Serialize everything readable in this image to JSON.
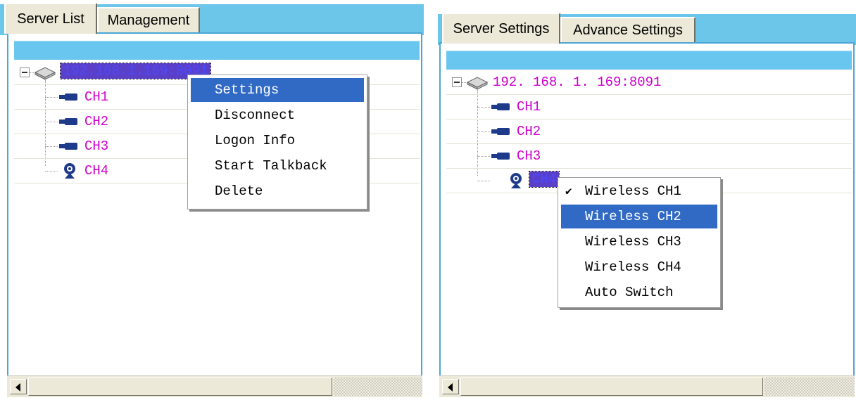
{
  "left": {
    "tabs": [
      {
        "label": "Server List",
        "active": true
      },
      {
        "label": "Management",
        "active": false
      }
    ],
    "tree": {
      "server_label": "192.168.1.169:8091",
      "server_selected": true,
      "channels": [
        {
          "label": "CH1",
          "icon": "camera-icon"
        },
        {
          "label": "CH2",
          "icon": "camera-icon"
        },
        {
          "label": "CH3",
          "icon": "camera-icon"
        },
        {
          "label": "CH4",
          "icon": "wireless-camera-icon"
        }
      ]
    },
    "context_menu": {
      "items": [
        {
          "label": "Settings",
          "highlighted": true
        },
        {
          "label": "Disconnect",
          "highlighted": false
        },
        {
          "label": "Logon Info",
          "highlighted": false
        },
        {
          "label": "Start Talkback",
          "highlighted": false
        },
        {
          "label": "Delete",
          "highlighted": false
        }
      ]
    }
  },
  "right": {
    "tabs": [
      {
        "label": "Server Settings",
        "active": true
      },
      {
        "label": "Advance Settings",
        "active": false
      }
    ],
    "tree": {
      "server_label": "192. 168. 1. 169:8091",
      "channels": [
        {
          "label": "CH1",
          "icon": "camera-icon"
        },
        {
          "label": "CH2",
          "icon": "camera-icon"
        },
        {
          "label": "CH3",
          "icon": "camera-icon"
        },
        {
          "label": "CH4",
          "icon": "wireless-camera-icon",
          "selected": true
        }
      ]
    },
    "context_menu": {
      "items": [
        {
          "label": "Wireless CH1",
          "checked": true,
          "highlighted": false
        },
        {
          "label": "Wireless CH2",
          "checked": false,
          "highlighted": true
        },
        {
          "label": "Wireless CH3",
          "checked": false,
          "highlighted": false
        },
        {
          "label": "Wireless CH4",
          "checked": false,
          "highlighted": false
        },
        {
          "label": "Auto Switch",
          "checked": false,
          "highlighted": false
        }
      ],
      "check_glyph": "✔"
    }
  },
  "colors": {
    "tab_strip": "#6cc6ea",
    "header_bar": "#69c6ee",
    "tree_text": "#cc00cc",
    "selection": "#5a3fc8",
    "menu_highlight": "#316ac5"
  }
}
